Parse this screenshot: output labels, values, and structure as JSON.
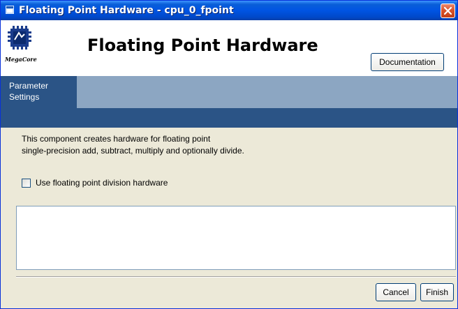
{
  "window": {
    "title": "Floating Point Hardware - cpu_0_fpoint"
  },
  "header": {
    "logo_text": "MegaCore",
    "title": "Floating Point Hardware",
    "documentation_label": "Documentation"
  },
  "tabs": [
    {
      "line1": "Parameter",
      "line2": "Settings",
      "selected": true
    }
  ],
  "content": {
    "description_line1": "This component creates hardware for floating point",
    "description_line2": "single-precision add, subtract, multiply and optionally divide.",
    "division_label": "Use floating point division hardware",
    "division_checked": false,
    "message_text": ""
  },
  "footer": {
    "cancel_label": "Cancel",
    "finish_label": "Finish"
  },
  "colors": {
    "titlebar": "#0054e3",
    "tab_background": "#2b5486",
    "tabstrip": "#8ca6c2",
    "dialog_background": "#ece9d8"
  },
  "icons": {
    "title": "window-icon",
    "close": "close-icon",
    "logo": "megacore-logo"
  }
}
